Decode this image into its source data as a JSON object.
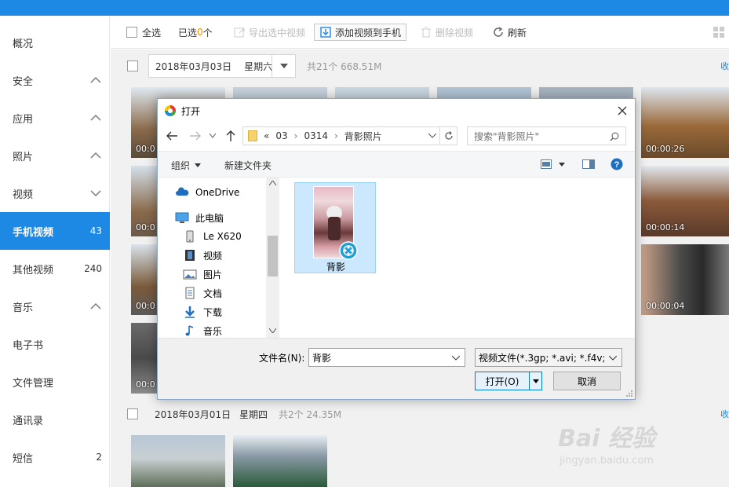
{
  "sidebar": {
    "items": [
      {
        "label": "概况",
        "count": ""
      },
      {
        "label": "安全",
        "count": ""
      },
      {
        "label": "应用",
        "count": ""
      },
      {
        "label": "照片",
        "count": ""
      },
      {
        "label": "视频",
        "count": ""
      },
      {
        "label": "手机视频",
        "count": "43"
      },
      {
        "label": "其他视频",
        "count": "240"
      },
      {
        "label": "音乐",
        "count": ""
      },
      {
        "label": "电子书",
        "count": ""
      },
      {
        "label": "文件管理",
        "count": ""
      },
      {
        "label": "通讯录",
        "count": ""
      },
      {
        "label": "短信",
        "count": "2"
      }
    ]
  },
  "toolbar": {
    "select_all": "全选",
    "selected_prefix": "已选",
    "selected_count": "0",
    "selected_suffix": "个",
    "export": "导出选中视频",
    "add": "添加视频到手机",
    "delete": "删除视频",
    "refresh": "刷新"
  },
  "groups": [
    {
      "date": "2018年03月03日",
      "weekday": "星期六",
      "summary": "共21个 668.51M"
    },
    {
      "date": "2018年03月01日",
      "weekday": "星期四",
      "summary": "共2个 24.35M"
    }
  ],
  "collapse_label": "收",
  "thumbnails": {
    "left_durations": [
      "00:0",
      "00:0",
      "00:0",
      "00:0"
    ],
    "right_durations": [
      "00:00:26",
      "00:00:14",
      "00:00:04"
    ]
  },
  "dialog": {
    "title": "打开",
    "path": [
      "«",
      "03",
      "0314",
      "背影照片"
    ],
    "search_placeholder": "搜索\"背影照片\"",
    "organize": "组织",
    "new_folder": "新建文件夹",
    "nav_items": [
      "OneDrive",
      "此电脑",
      "Le X620",
      "视频",
      "图片",
      "文档",
      "下载",
      "音乐"
    ],
    "file_name": "背影",
    "filename_label": "文件名(N):",
    "filename_value": "背影",
    "filter": "视频文件(*.3gp; *.avi; *.f4v; *.f",
    "open_button": "打开(O)",
    "cancel_button": "取消"
  },
  "watermark": {
    "brand": "Bai 经验",
    "url": "jingyan.baidu.com"
  },
  "colors": {
    "accent": "#1e88e5",
    "orange": "#f28c00"
  }
}
